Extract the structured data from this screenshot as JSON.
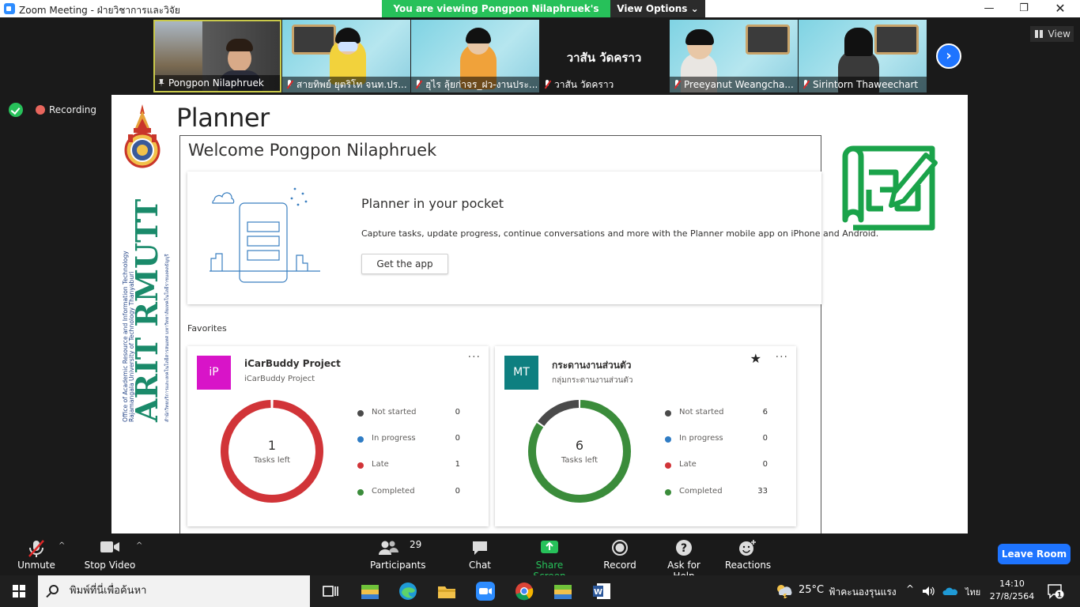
{
  "window": {
    "title": "Zoom Meeting - ฝ่ายวิชาการและวิจัย",
    "share_banner": "You are viewing Pongpon Nilaphruek's screen",
    "view_options": "View Options"
  },
  "gallery": {
    "participants": [
      {
        "name": "Pongpon Nilaphruek",
        "muted": false,
        "pinned": true
      },
      {
        "name": "สายทิพย์ ยุตริโท จนท.ปร...",
        "muted": true
      },
      {
        "name": "ฮุไร ลุ้ยก่าจร_ฝว-งานประ...",
        "muted": true
      },
      {
        "name": "วาสัน วัดคราว",
        "muted": true,
        "center_label": "วาสัน วัดคราว"
      },
      {
        "name": "Preeyanut Weangcha...",
        "muted": true
      },
      {
        "name": "Sirintorn Thaweechart",
        "muted": true
      }
    ],
    "view_label": "View"
  },
  "status": {
    "recording_label": "Recording"
  },
  "shared_screen": {
    "logo": {
      "brand": "ARIT RMUTT",
      "line1": "Office of Academic Resource and Information Technology",
      "line2": "Rajamangala University of Technology Thanyaburi",
      "line3": "สำนักวิทยบริการและเทคโนโลยีสารสนเทศ มหาวิทยาลัยเทคโนโลยีราชมงคลธัญบุรี"
    },
    "app_title": "Planner",
    "welcome": "Welcome Pongpon Nilaphruek",
    "pocket": {
      "title": "Planner in your pocket",
      "description": "Capture tasks, update progress, continue conversations and more with the Planner mobile app on iPhone and Android.",
      "button": "Get the app"
    },
    "favorites_label": "Favorites",
    "plans": [
      {
        "initials": "iP",
        "avatar_color": "#d814c8",
        "name": "iCarBuddy Project",
        "group": "iCarBuddy Project",
        "starred": false,
        "tasks_left": "1",
        "tasks_left_label": "Tasks left",
        "stats": [
          {
            "label": "Not started",
            "value": 0,
            "color": "#4a4a4a"
          },
          {
            "label": "In progress",
            "value": 0,
            "color": "#2f7cc4"
          },
          {
            "label": "Late",
            "value": 1,
            "color": "#d13438"
          },
          {
            "label": "Completed",
            "value": 0,
            "color": "#3b8c3b"
          }
        ]
      },
      {
        "initials": "MT",
        "avatar_color": "#0e7f80",
        "name": "กระดานงานส่วนตัว",
        "group": "กลุ่มกระดานงานส่วนตัว",
        "starred": true,
        "tasks_left": "6",
        "tasks_left_label": "Tasks left",
        "stats": [
          {
            "label": "Not started",
            "value": 6,
            "color": "#4a4a4a"
          },
          {
            "label": "In progress",
            "value": 0,
            "color": "#2f7cc4"
          },
          {
            "label": "Late",
            "value": 0,
            "color": "#d13438"
          },
          {
            "label": "Completed",
            "value": 33,
            "color": "#3b8c3b"
          }
        ]
      }
    ]
  },
  "toolbar": {
    "unmute": "Unmute",
    "stop_video": "Stop Video",
    "participants": "Participants",
    "participants_count": "29",
    "chat": "Chat",
    "share_screen": "Share Screen",
    "record": "Record",
    "ask_for_help": "Ask for Help",
    "reactions": "Reactions",
    "leave": "Leave Room"
  },
  "taskbar": {
    "search_placeholder": "พิมพ์ที่นี่เพื่อค้นหา",
    "temperature": "25°C",
    "weather": "ฟ้าคะนองรุนแรง",
    "language": "ไทย",
    "time": "14:10",
    "date": "27/8/2564",
    "notifications": "1"
  },
  "colors": {
    "zoom_blue": "#1e74ff",
    "share_green": "#27c15a",
    "planner_green": "#1aa34a"
  }
}
